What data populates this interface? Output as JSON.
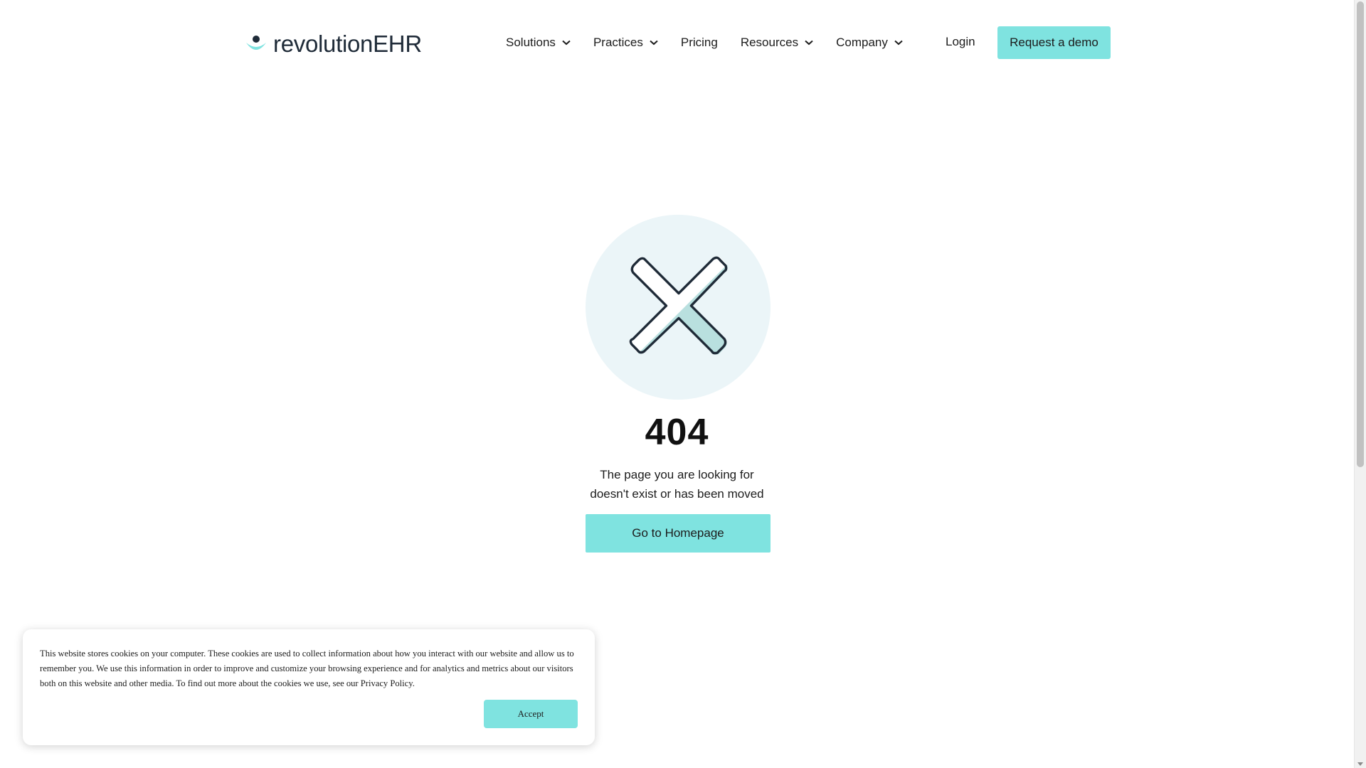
{
  "header": {
    "logo": {
      "text_main": "revolution",
      "text_accent": "EHR",
      "icon": "smile-logo-icon"
    },
    "nav": [
      {
        "label": "Solutions",
        "has_dropdown": true
      },
      {
        "label": "Practices",
        "has_dropdown": true
      },
      {
        "label": "Pricing",
        "has_dropdown": false
      },
      {
        "label": "Resources",
        "has_dropdown": true
      },
      {
        "label": "Company",
        "has_dropdown": true
      }
    ],
    "login_label": "Login",
    "demo_label": "Request a demo"
  },
  "main": {
    "icon": "close-x-icon",
    "error_code": "404",
    "message_line1": "The page you are looking for",
    "message_line2": "doesn't exist or has been moved",
    "home_button_label": "Go to Homepage"
  },
  "cookie_banner": {
    "text": "This website stores cookies on your computer. These cookies are used to collect information about how you interact with our website and allow us to remember you. We use this information in order to improve and customize your browsing experience and for analytics and metrics about our visitors both on this website and other media. To find out more about the cookies we use, see our Privacy Policy.",
    "accept_label": "Accept"
  },
  "colors": {
    "accent": "#7fe3e0",
    "circle_bg": "#ebf5f8",
    "x_fill": "#b9e0df",
    "dark": "#1f2b38"
  }
}
